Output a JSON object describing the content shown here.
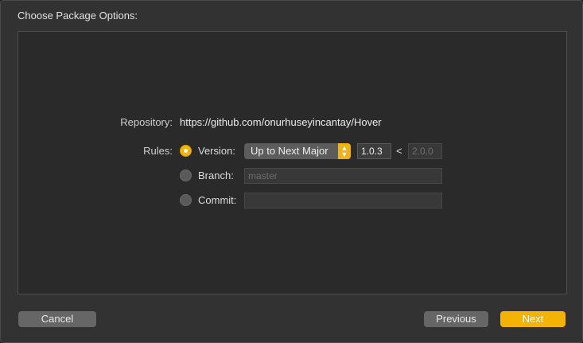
{
  "dialog": {
    "title": "Choose Package Options:"
  },
  "repository": {
    "label": "Repository:",
    "url": "https://github.com/onurhuseyincantay/Hover"
  },
  "rules": {
    "label": "Rules:",
    "version": {
      "label": "Version:",
      "selected": true,
      "popup_value": "Up to Next Major",
      "lower_bound": "1.0.3",
      "less_than": "<",
      "upper_bound": "2.0.0"
    },
    "branch": {
      "label": "Branch:",
      "selected": false,
      "placeholder": "master"
    },
    "commit": {
      "label": "Commit:",
      "selected": false,
      "value": ""
    }
  },
  "footer": {
    "cancel_label": "Cancel",
    "previous_label": "Previous",
    "next_label": "Next"
  },
  "colors": {
    "accent": "#f5b301",
    "background": "#323232"
  }
}
